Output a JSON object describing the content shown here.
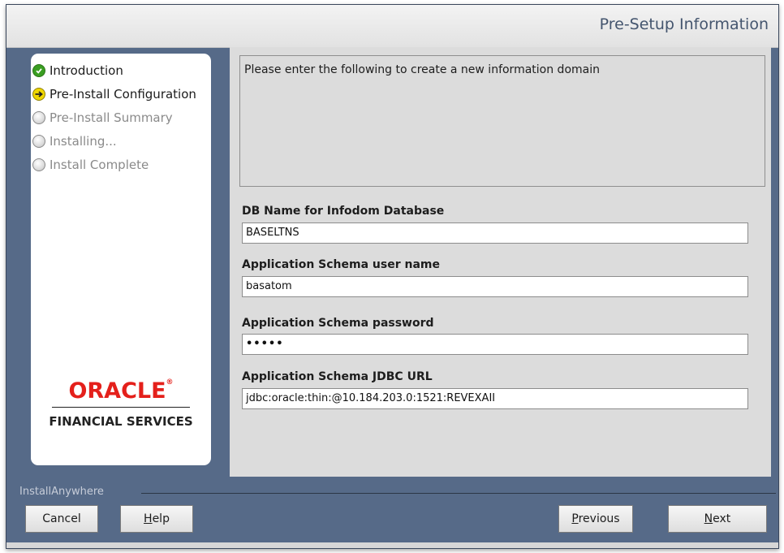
{
  "header": {
    "title": "Pre-Setup Information"
  },
  "steps": [
    {
      "label": "Introduction",
      "state": "done",
      "icon": "check-icon"
    },
    {
      "label": "Pre-Install Configuration",
      "state": "current",
      "icon": "arrow-right-icon"
    },
    {
      "label": "Pre-Install Summary",
      "state": "pending",
      "icon": "circle-icon"
    },
    {
      "label": "Installing...",
      "state": "pending",
      "icon": "circle-icon"
    },
    {
      "label": "Install Complete",
      "state": "pending",
      "icon": "circle-icon"
    }
  ],
  "logo": {
    "brand": "ORACLE",
    "mark": "®",
    "subtitle": "FINANCIAL SERVICES"
  },
  "content": {
    "description": "Please enter the following to create a new information domain",
    "fields": [
      {
        "label": "DB Name for Infodom Database",
        "value": "BASELTNS"
      },
      {
        "label": "Application Schema user name",
        "value": "basatom"
      },
      {
        "label": "Application Schema password",
        "value": "•••••"
      },
      {
        "label": "Application Schema JDBC URL",
        "value": "jdbc:oracle:thin:@10.184.203.0:1521:REVEXAII"
      }
    ]
  },
  "footer": {
    "installer": "InstallAnywhere",
    "buttons": {
      "cancel": "Cancel",
      "help_mnemonic": "H",
      "help_rest": "elp",
      "previous_mnemonic": "P",
      "previous_rest": "revious",
      "next_mnemonic": "N",
      "next_rest": "ext"
    }
  },
  "colors": {
    "frame": "#566a88",
    "content_bg": "#dcdcdc",
    "oracle_red": "#e4201b",
    "done": "#3a9e22",
    "current": "#f0d700"
  }
}
